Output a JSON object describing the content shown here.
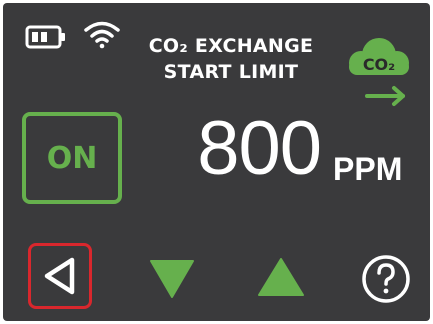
{
  "header": {
    "battery_icon": "battery-icon",
    "wifi_icon": "wifi-icon",
    "title_line1": "CO₂ EXCHANGE",
    "title_line2": "START LIMIT",
    "cloud_label": "CO₂",
    "cloud_icon": "co2-cloud-icon",
    "arrow_icon": "arrow-right-icon"
  },
  "main": {
    "toggle_label": "ON",
    "value": "800",
    "unit": "PPM"
  },
  "footer": {
    "back_icon": "back-triangle-icon",
    "down_icon": "down-triangle-icon",
    "up_icon": "up-triangle-icon",
    "help_icon": "help-circle-icon"
  },
  "colors": {
    "background": "#3a3a3c",
    "accent_green": "#66b04d",
    "selection_red": "#d9272d",
    "text": "#ffffff"
  }
}
